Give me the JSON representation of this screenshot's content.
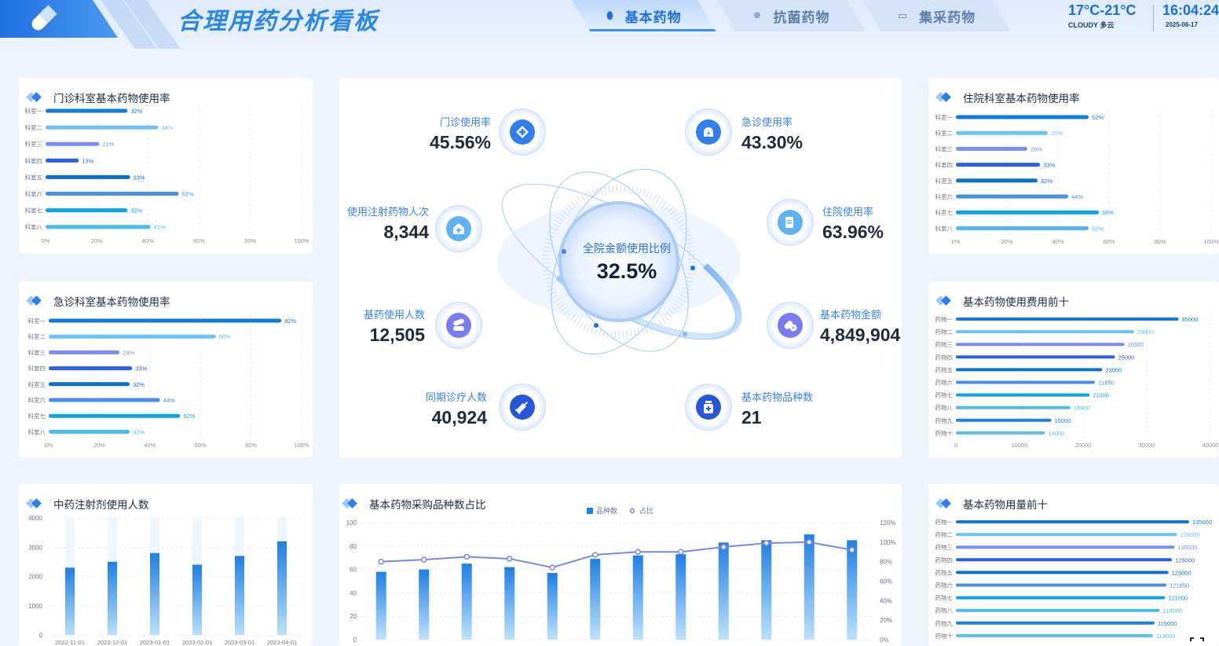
{
  "header": {
    "title": "合理用药分析看板",
    "tabs": [
      {
        "label": "基本药物",
        "icon": "pill-icon",
        "active": true
      },
      {
        "label": "抗菌药物",
        "icon": "virus-icon",
        "active": false
      },
      {
        "label": "集采药物",
        "icon": "box-icon",
        "active": false
      }
    ],
    "weather": {
      "temp": "17°C-21°C",
      "condition": "CLOUDY 多云"
    },
    "time": "16:04:24",
    "date": "2025-06-17"
  },
  "colors": {
    "accent": "#2f7ff0",
    "title": "#2a86e8",
    "bars": [
      "#1479d8",
      "#6cc2f5",
      "#7b8cf7",
      "#2b5fe8",
      "#0f6fc8",
      "#4a8fe6",
      "#0ea2e6",
      "#4db9f0",
      "#1f7fe5",
      "#5cbff2"
    ]
  },
  "kpis": {
    "center": {
      "label": "全院金额使用比例",
      "value": "32.5%"
    },
    "outpatient": {
      "label": "门诊使用率",
      "value": "45.56%",
      "icon": "medical-cross-icon"
    },
    "emergency": {
      "label": "急诊使用率",
      "value": "43.30%",
      "icon": "alarm-icon"
    },
    "injection": {
      "label": "使用注射药物人次",
      "value": "8,344",
      "icon": "hospital-icon"
    },
    "inpatient": {
      "label": "住院使用率",
      "value": "63.96%",
      "icon": "clipboard-icon"
    },
    "essential_users": {
      "label": "基药使用人数",
      "value": "12,505",
      "icon": "capsule-icon"
    },
    "essential_amount": {
      "label": "基本药物金额",
      "value": "4,849,904",
      "icon": "pill-money-icon"
    },
    "visits": {
      "label": "同期诊疗人数",
      "value": "40,924",
      "icon": "syringe-icon"
    },
    "varieties": {
      "label": "基本药物品种数",
      "value": "21",
      "icon": "medicine-bottle-icon"
    }
  },
  "chart_data": [
    {
      "id": "outpatient",
      "type": "bar",
      "orientation": "horizontal",
      "title": "门诊科室基本药物使用率",
      "categories": [
        "科室一",
        "科室二",
        "科室三",
        "科室四",
        "科室五",
        "科室六",
        "科室七",
        "科室八"
      ],
      "values": [
        32,
        44,
        21,
        13,
        33,
        52,
        32,
        41
      ],
      "labels": [
        "32%",
        "44%",
        "21%",
        "13%",
        "33%",
        "52%",
        "32%",
        "41%"
      ],
      "xticks": [
        "0%",
        "20%",
        "40%",
        "60%",
        "80%",
        "100%"
      ],
      "xlim": [
        0,
        100
      ]
    },
    {
      "id": "emergency",
      "type": "bar",
      "orientation": "horizontal",
      "title": "急诊科室基本药物使用率",
      "categories": [
        "科室一",
        "科室二",
        "科室三",
        "科室四",
        "科室五",
        "科室六",
        "科室七",
        "科室八"
      ],
      "values": [
        92,
        66,
        28,
        33,
        32,
        44,
        52,
        32
      ],
      "labels": [
        "92%",
        "66%",
        "28%",
        "33%",
        "32%",
        "44%",
        "52%",
        "32%"
      ],
      "xticks": [
        "0%",
        "20%",
        "40%",
        "60%",
        "80%",
        "100%"
      ],
      "xlim": [
        0,
        100
      ]
    },
    {
      "id": "inpatient",
      "type": "bar",
      "orientation": "horizontal",
      "title": "住院科室基本药物使用率",
      "categories": [
        "科室一",
        "科室二",
        "科室三",
        "科室四",
        "科室五",
        "科室六",
        "科室七",
        "科室八"
      ],
      "values": [
        52,
        36,
        28,
        33,
        32,
        44,
        56,
        52
      ],
      "labels": [
        "52%",
        "36%",
        "28%",
        "33%",
        "32%",
        "44%",
        "56%",
        "52%"
      ],
      "xticks": [
        "0%",
        "20%",
        "40%",
        "60%",
        "80%",
        "100%"
      ],
      "xlim": [
        0,
        100
      ]
    },
    {
      "id": "cost_top10",
      "type": "bar",
      "orientation": "horizontal",
      "title": "基本药物使用费用前十",
      "categories": [
        "药物一",
        "药物二",
        "药物三",
        "药物四",
        "药物五",
        "药物六",
        "药物七",
        "药物八",
        "药物九",
        "药物十"
      ],
      "values": [
        35000,
        28000,
        26500,
        25000,
        23000,
        21850,
        21000,
        18000,
        15000,
        14000
      ],
      "labels": [
        "35000",
        "28000",
        "26500",
        "25000",
        "23000",
        "21850",
        "21000",
        "18000",
        "15000",
        "14000"
      ],
      "xticks": [
        "0",
        "10000",
        "20000",
        "30000",
        "40000"
      ],
      "xlim": [
        0,
        40000
      ]
    },
    {
      "id": "usage_top10",
      "type": "bar",
      "orientation": "horizontal",
      "title": "基本药物用量前十",
      "categories": [
        "药物一",
        "药物二",
        "药物三",
        "药物四",
        "药物五",
        "药物六",
        "药物七",
        "药物八",
        "药物九",
        "药物十"
      ],
      "values": [
        135000,
        128000,
        126500,
        125000,
        123000,
        121850,
        121000,
        118000,
        115000,
        114000
      ],
      "labels": [
        "135000",
        "128000",
        "126500",
        "125000",
        "123000",
        "121850",
        "121000",
        "118000",
        "115000",
        "114000"
      ],
      "xlim": [
        0,
        140000
      ]
    },
    {
      "id": "tcm_injection",
      "type": "bar",
      "title": "中药注射剂使用人数",
      "categories": [
        "2022-11-01",
        "2022-12-01",
        "2023-01-01",
        "2023-02-01",
        "2023-03-01",
        "2023-04-01"
      ],
      "values": [
        2300,
        2500,
        2800,
        2400,
        2700,
        3200
      ],
      "yticks": [
        "0",
        "1000",
        "2000",
        "3000",
        "4000"
      ],
      "ylim": [
        0,
        4000
      ]
    },
    {
      "id": "procurement",
      "type": "bar",
      "title": "基本药物采购品种数占比",
      "legend": [
        "品种数",
        "占比"
      ],
      "series": [
        {
          "name": "品种数",
          "type": "bar",
          "values": [
            58,
            60,
            65,
            62,
            57,
            69,
            72,
            73,
            83,
            85,
            90,
            85
          ]
        },
        {
          "name": "占比",
          "type": "line",
          "values": [
            80,
            82,
            85,
            83,
            74,
            87,
            90,
            90,
            95,
            99,
            100,
            92
          ]
        }
      ],
      "yticks_left": [
        "0",
        "20",
        "40",
        "60",
        "80",
        "100"
      ],
      "ylim_left": [
        0,
        100
      ],
      "yticks_right": [
        "0%",
        "20%",
        "40%",
        "60%",
        "80%",
        "100%",
        "120%"
      ],
      "ylim_right": [
        0,
        120
      ]
    }
  ]
}
